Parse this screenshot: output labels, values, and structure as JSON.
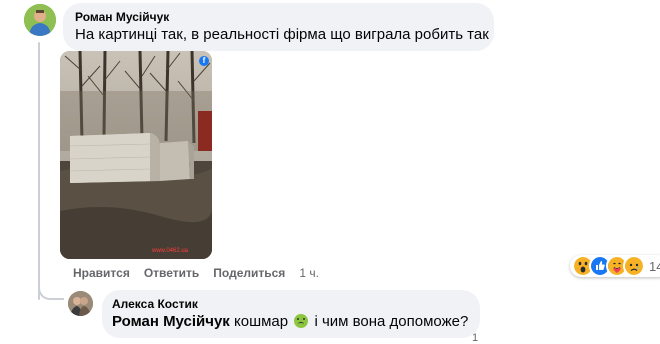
{
  "comments": [
    {
      "author": "Роман Мусійчук",
      "text": "На картинці так, в реальності фірма що виграла робить так",
      "actions": {
        "like": "Нравится",
        "reply": "Ответить",
        "share": "Поделиться",
        "time": "1 ч."
      },
      "reactions": {
        "icons": [
          "wow-reaction",
          "like-reaction",
          "care-reaction",
          "sad-reaction"
        ],
        "count": "14"
      },
      "photo": {
        "watermark": "www.0462.ua",
        "badge": "f"
      }
    },
    {
      "author": "Алекса Костик",
      "mention": "Роман Мусійчук",
      "text_before_emoji": " кошмар ",
      "text_after_emoji": " і чим вона допоможе?",
      "emoji": "nauseated-face",
      "partial_count": "1"
    }
  ],
  "colors": {
    "bubble": "#f0f2f5",
    "meta_text": "#65676b",
    "thread_line": "#ccd0d5",
    "like_blue": "#1877f2"
  }
}
